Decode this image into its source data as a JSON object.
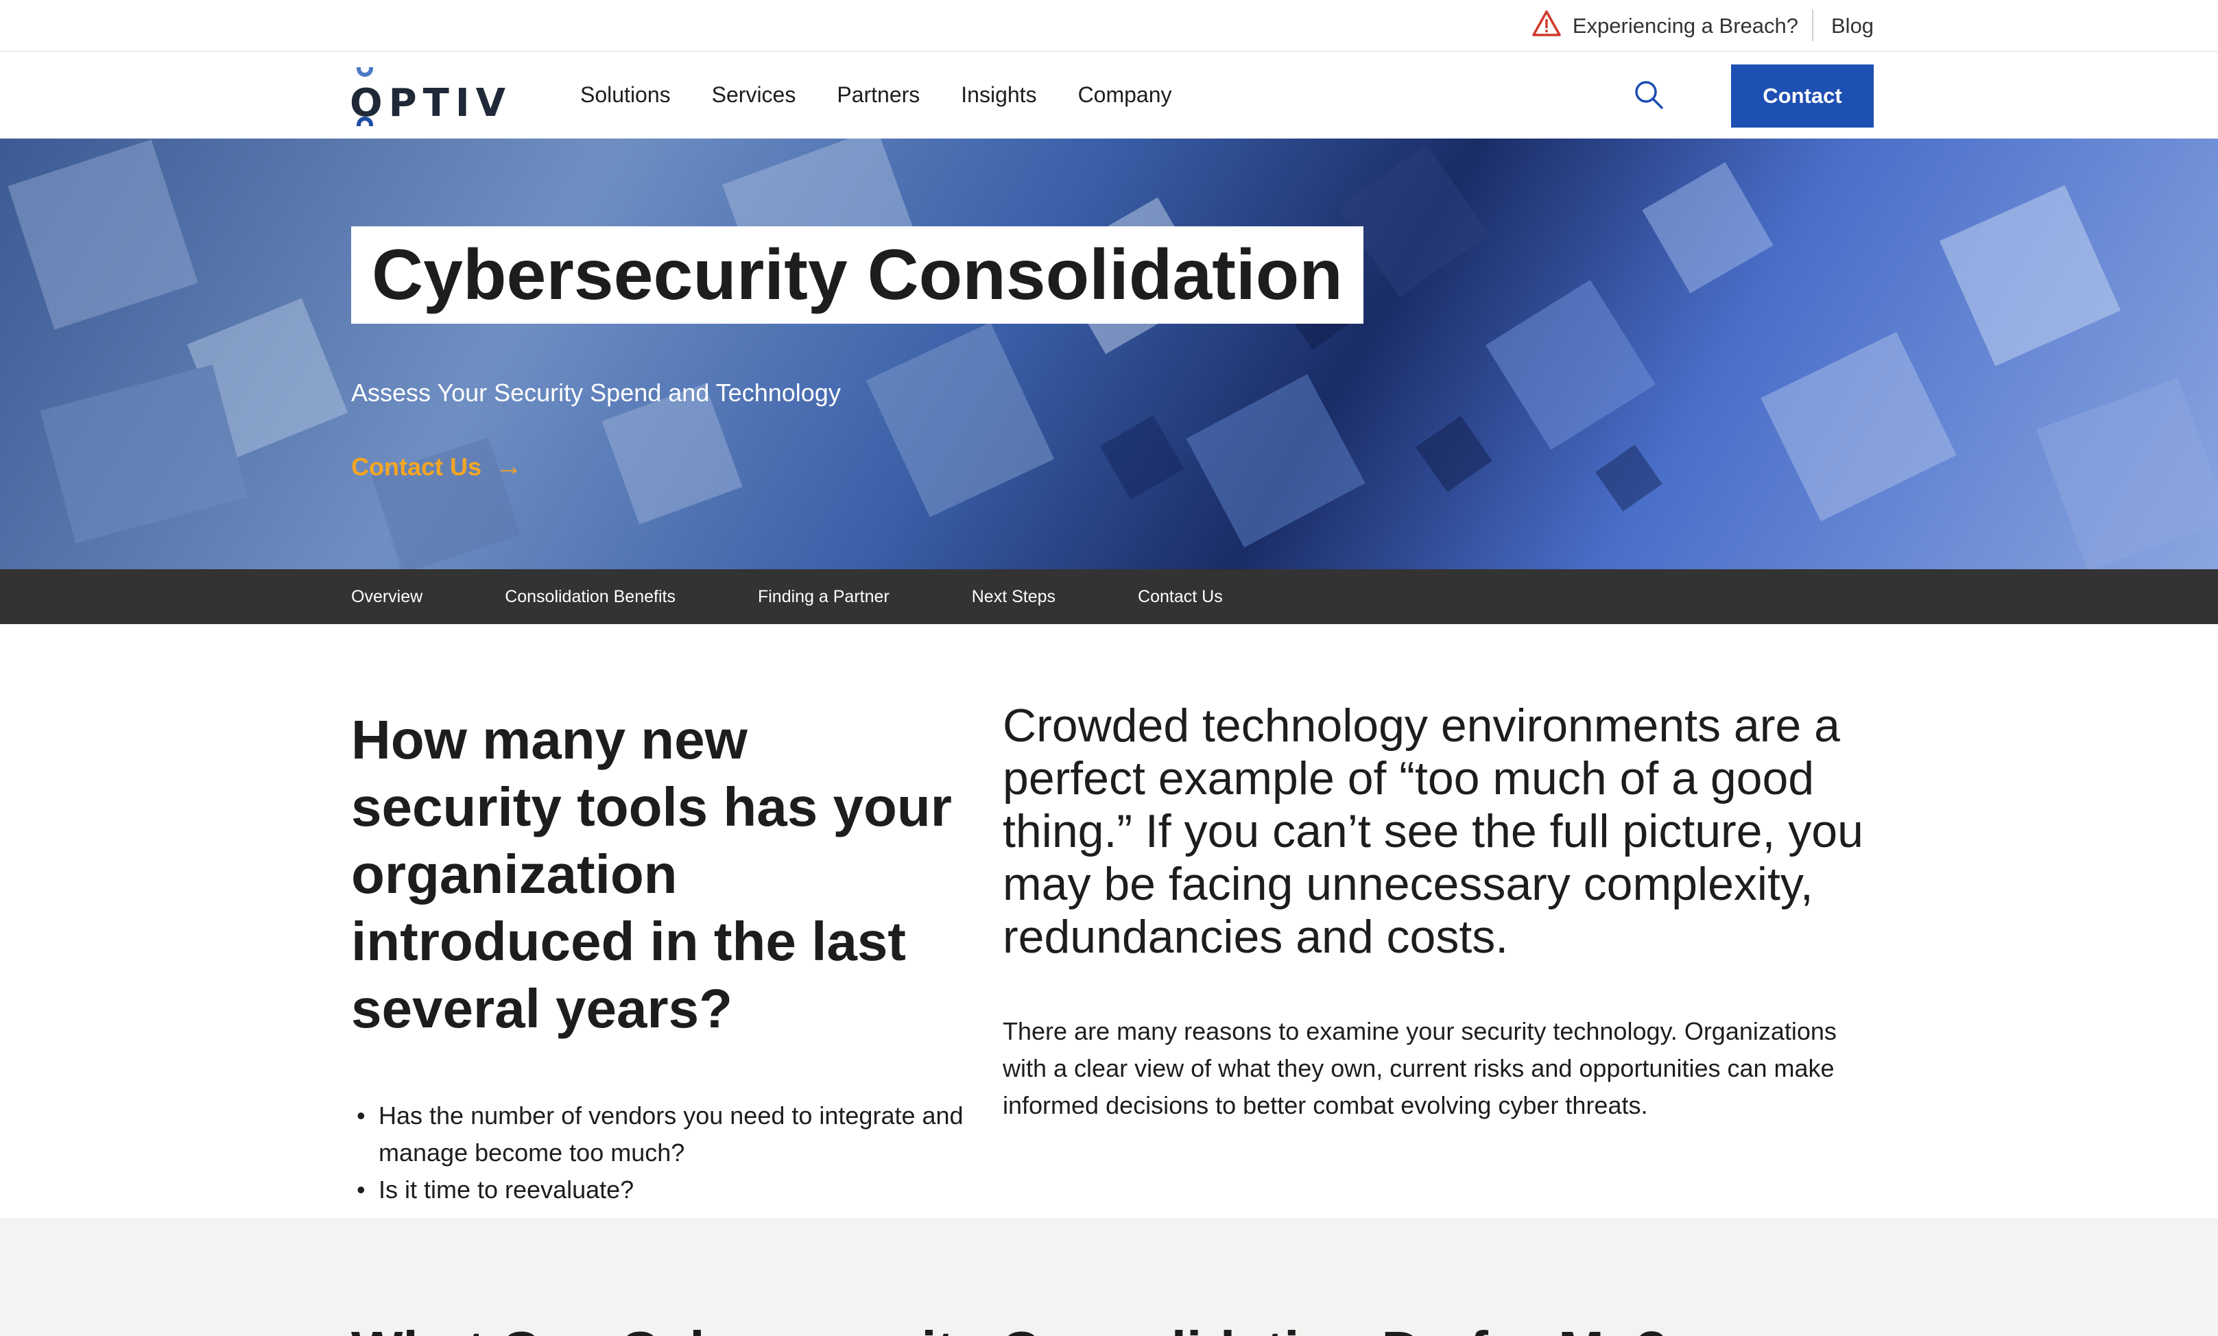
{
  "utility_bar": {
    "breach_link": "Experiencing a Breach?",
    "blog_link": "Blog",
    "warning_icon": "warning-triangle-icon"
  },
  "header": {
    "logo_text": "OPTIV",
    "nav": [
      "Solutions",
      "Services",
      "Partners",
      "Insights",
      "Company"
    ],
    "search_icon": "search-icon",
    "contact_button": "Contact",
    "accent_color": "#1e4fb2"
  },
  "hero": {
    "title": "Cybersecurity Consolidation",
    "subtitle": "Assess Your Security Spend and Technology",
    "cta": "Contact Us",
    "cta_icon": "arrow-right-icon",
    "cta_color": "#f5a623"
  },
  "section_nav": [
    "Overview",
    "Consolidation Benefits",
    "Finding a Partner",
    "Next Steps",
    "Contact Us"
  ],
  "overview": {
    "question": "How many new security tools has your organization introduced in the last several years?",
    "bullets": [
      "Has the number of vendors you need to integrate and manage become too much?",
      "Is it time to reevaluate?"
    ],
    "lead": "Crowded technology environments are a perfect example of “too much of a good thing.” If you can’t see the full picture, you may be facing unnecessary complexity, redundancies and costs.",
    "body": "There are many reasons to examine your security technology. Organizations with a clear view of what they own, current risks and opportunities can make informed decisions to better combat evolving cyber threats."
  },
  "next_section": {
    "heading": "What Can Cybersecurity Consolidation Do for Me?"
  }
}
